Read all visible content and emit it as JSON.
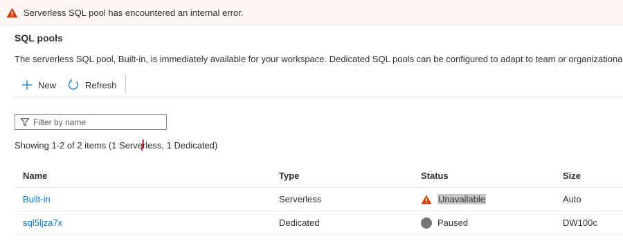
{
  "banner": {
    "icon": "warning-icon",
    "message": "Serverless SQL pool has encountered an internal error."
  },
  "page": {
    "title": "SQL pools",
    "description": "The serverless SQL pool, Built-in, is immediately available for your workspace. Dedicated SQL pools can be configured to adapt to team or organizational n"
  },
  "toolbar": {
    "new_label": "New",
    "refresh_label": "Refresh"
  },
  "filter": {
    "placeholder": "Filter by name",
    "value": ""
  },
  "summary": "Showing 1-2 of 2 items (1 Serverless, 1 Dedicated)",
  "table": {
    "columns": [
      "Name",
      "Type",
      "Status",
      "Size"
    ],
    "rows": [
      {
        "name": "Built-in",
        "type": "Serverless",
        "status": "Unavailable",
        "status_icon": "warning-icon",
        "size": "Auto"
      },
      {
        "name": "sql5ljza7x",
        "type": "Dedicated",
        "status": "Paused",
        "status_icon": "paused-dot-icon",
        "size": "DW100c"
      }
    ]
  },
  "colors": {
    "accent": "#0078d4",
    "warning": "#d83b01",
    "banner_bg": "#fdf6f3",
    "paused": "#797775"
  }
}
